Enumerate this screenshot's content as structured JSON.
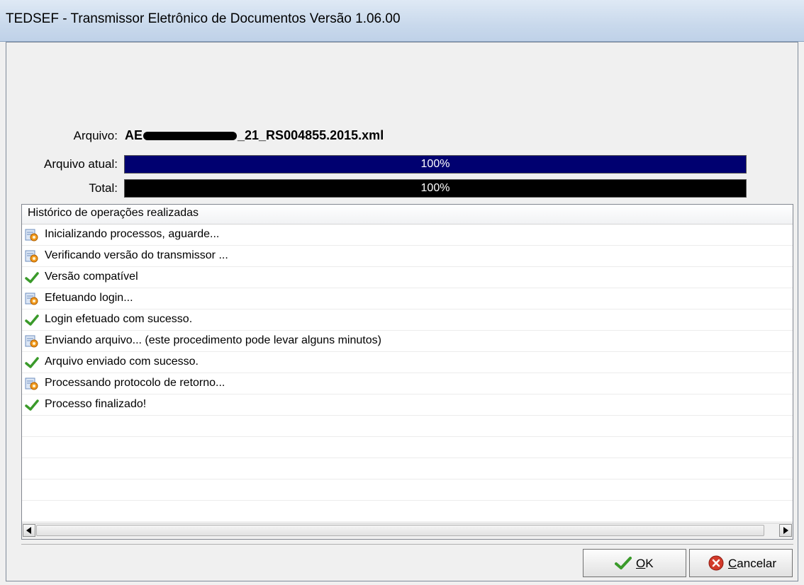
{
  "window": {
    "title": "TEDSEF - Transmissor Eletrônico de Documentos  Versão 1.06.00"
  },
  "file": {
    "label": "Arquivo:",
    "prefix": "AE",
    "suffix": "_21_RS004855.2015.xml"
  },
  "progress": [
    {
      "label": "Arquivo atual:",
      "percent_text": "100%",
      "value": 1.0,
      "color": "#000070"
    },
    {
      "label": "Total:",
      "percent_text": "100%",
      "value": 1.0,
      "color": "#000000"
    }
  ],
  "history": {
    "header": "Histórico de operações realizadas",
    "items": [
      {
        "icon": "gear-icon",
        "text": "Inicializando processos, aguarde..."
      },
      {
        "icon": "gear-icon",
        "text": "Verificando versão do transmissor ..."
      },
      {
        "icon": "check-icon",
        "text": "Versão compatível"
      },
      {
        "icon": "gear-icon",
        "text": "Efetuando login..."
      },
      {
        "icon": "check-icon",
        "text": "Login efetuado com sucesso."
      },
      {
        "icon": "gear-icon",
        "text": "Enviando arquivo... (este procedimento pode levar alguns minutos)"
      },
      {
        "icon": "check-icon",
        "text": "Arquivo enviado com sucesso."
      },
      {
        "icon": "gear-icon",
        "text": "Processando protocolo de retorno..."
      },
      {
        "icon": "check-icon",
        "text": "Processo finalizado!"
      }
    ]
  },
  "buttons": {
    "ok": {
      "accel": "O",
      "rest": "K"
    },
    "cancel": {
      "accel": "C",
      "rest": "ancelar"
    }
  },
  "colors": {
    "check": "#3a9a2a",
    "cancel_icon": "#d23a2a"
  }
}
